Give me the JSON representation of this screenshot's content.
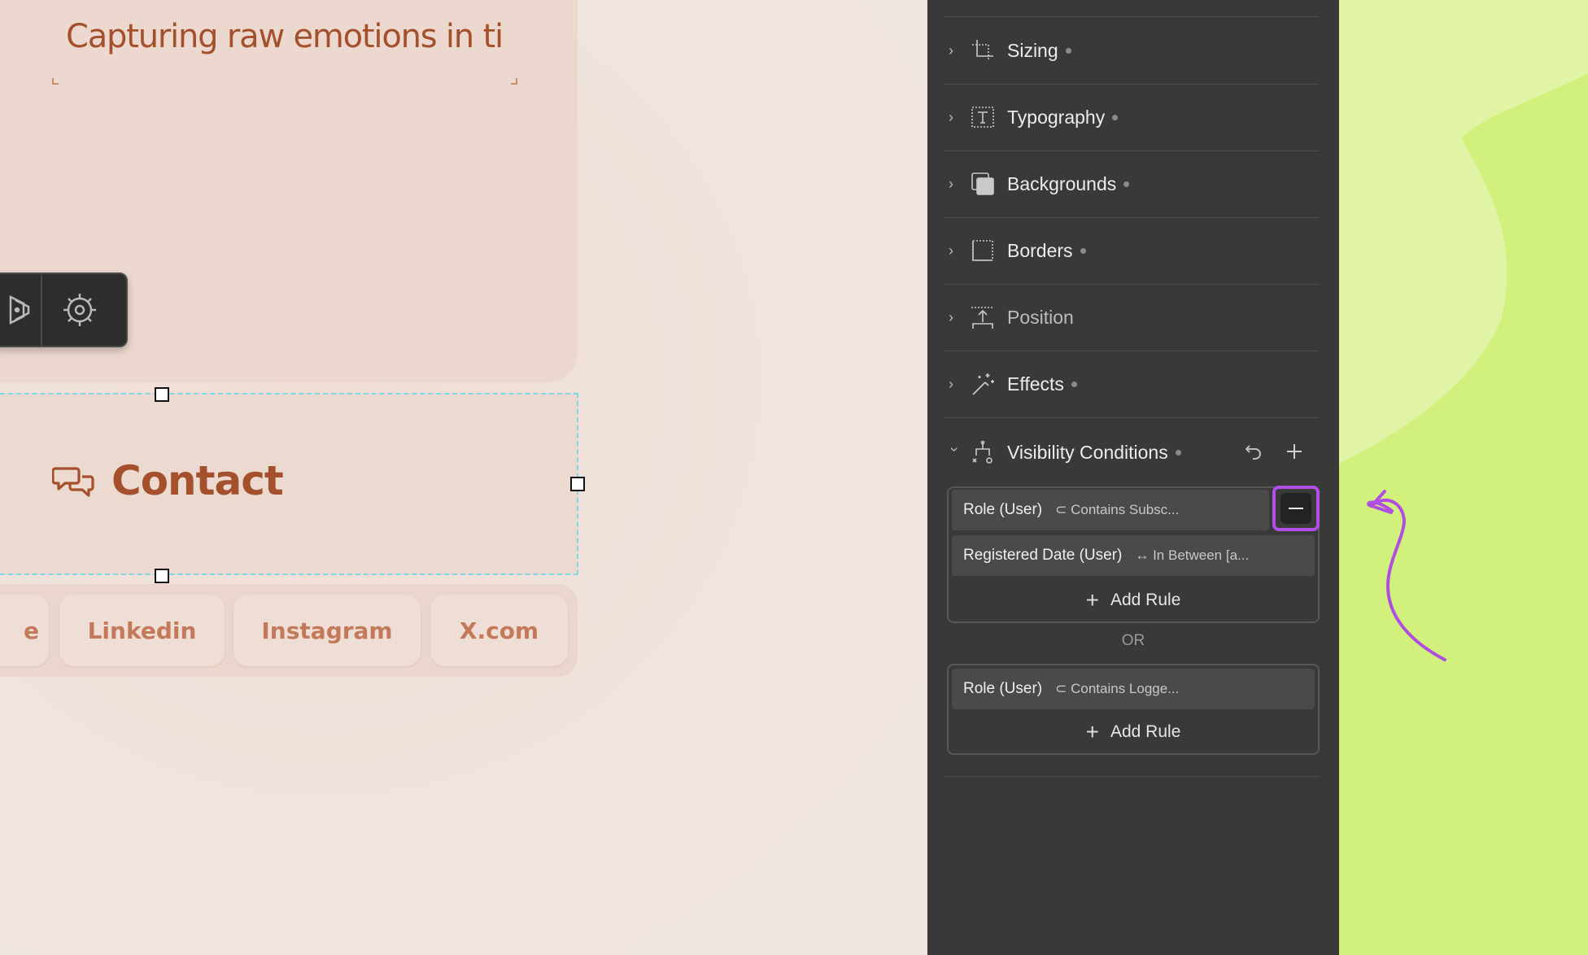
{
  "canvas": {
    "hero_text": "Capturing raw emotions in tim",
    "contact_label": "Contact",
    "social_links": [
      {
        "label": "e"
      },
      {
        "label": "Linkedin"
      },
      {
        "label": "Instagram"
      },
      {
        "label": "X.com"
      }
    ]
  },
  "panel": {
    "sections": [
      {
        "label": "Sizing",
        "icon": "sizing-icon"
      },
      {
        "label": "Typography",
        "icon": "typography-icon"
      },
      {
        "label": "Backgrounds",
        "icon": "backgrounds-icon"
      },
      {
        "label": "Borders",
        "icon": "borders-icon"
      },
      {
        "label": "Position",
        "icon": "position-icon"
      },
      {
        "label": "Effects",
        "icon": "effects-icon"
      }
    ],
    "visibility": {
      "title": "Visibility Conditions",
      "groups": [
        {
          "rules": [
            {
              "field": "Role (User)",
              "operator_symbol": "⊂",
              "operator": "Contains Subsc..."
            },
            {
              "field": "Registered Date (User)",
              "operator_symbol": "↔",
              "operator": "In Between [a..."
            }
          ],
          "add_rule": "Add Rule"
        },
        {
          "rules": [
            {
              "field": "Role (User)",
              "operator_symbol": "⊂",
              "operator": "Contains Logge..."
            }
          ],
          "add_rule": "Add Rule"
        }
      ],
      "separator": "OR"
    }
  },
  "colors": {
    "accent_highlight": "#b24ee7",
    "brand_text": "#a4502c",
    "selection_outline": "#7fd8ea",
    "panel_bg": "#393939",
    "deco_green": "#d2f17c"
  }
}
